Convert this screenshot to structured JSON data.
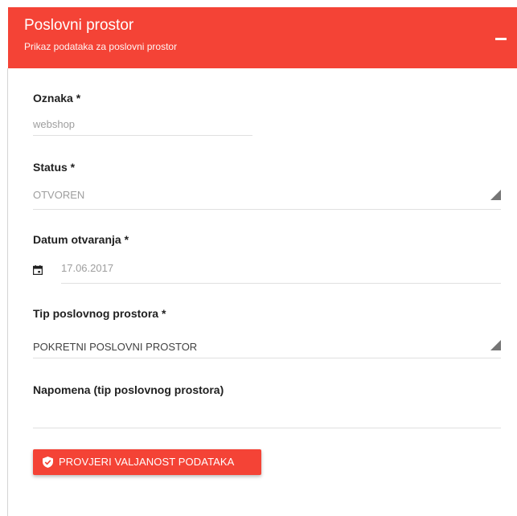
{
  "header": {
    "title": "Poslovni prostor",
    "subtitle": "Prikaz podataka za poslovni prostor",
    "collapse_icon": "minus-icon"
  },
  "form": {
    "oznaka": {
      "label": "Oznaka *",
      "value": "webshop"
    },
    "status": {
      "label": "Status *",
      "value": "OTVOREN",
      "icon": "dropdown-triangle-icon"
    },
    "datum": {
      "label": "Datum otvaranja *",
      "value": "17.06.2017",
      "icon": "calendar-icon"
    },
    "tip": {
      "label": "Tip poslovnog prostora *",
      "value": "POKRETNI POSLOVNI PROSTOR",
      "icon": "dropdown-triangle-icon"
    },
    "napomena": {
      "label": "Napomena (tip poslovnog prostora)",
      "value": ""
    }
  },
  "actions": {
    "validate_label": "PROVJERI VALJANOST PODATAKA",
    "validate_icon": "shield-check-icon"
  },
  "colors": {
    "accent": "#f44336",
    "text": "#212121",
    "muted": "#9e9e9e",
    "divider": "#e0e0e0"
  }
}
